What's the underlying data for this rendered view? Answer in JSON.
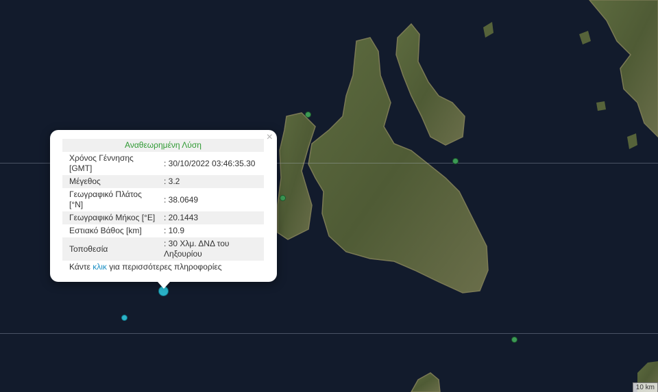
{
  "popup": {
    "title": "Αναθεωρημένη Λύση",
    "close_symbol": "×",
    "rows": [
      {
        "label": "Χρόνος Γέννησης [GMT]",
        "value": ": 30/10/2022 03:46:35.30"
      },
      {
        "label": "Μέγεθος",
        "value": ": 3.2"
      },
      {
        "label": "Γεωγραφικό Πλάτος [°N]",
        "value": ": 38.0649"
      },
      {
        "label": "Γεωγραφικό Μήκος [°E]",
        "value": ": 20.1443"
      },
      {
        "label": "Εστιακό Βάθος [km]",
        "value": ": 10.9"
      },
      {
        "label": "Τοποθεσία",
        "value": ": 30 Χλμ. ΔΝΔ του Ληξουρίου"
      }
    ],
    "more_prefix": "Κάντε ",
    "more_link": "κλικ",
    "more_suffix": " για περισσότερες πληροφορίες"
  },
  "scale": {
    "label": "10 km"
  },
  "markers": [
    {
      "kind": "green",
      "icon": "earthquake-marker-icon"
    },
    {
      "kind": "cyan",
      "icon": "earthquake-marker-icon"
    }
  ],
  "colors": {
    "sea": "#121b2c",
    "land": "#4d5a33",
    "green_marker": "#3c9a55",
    "cyan_marker": "#2ab3c8",
    "popup_title": "#2f9a33",
    "link": "#1a8fc4"
  }
}
